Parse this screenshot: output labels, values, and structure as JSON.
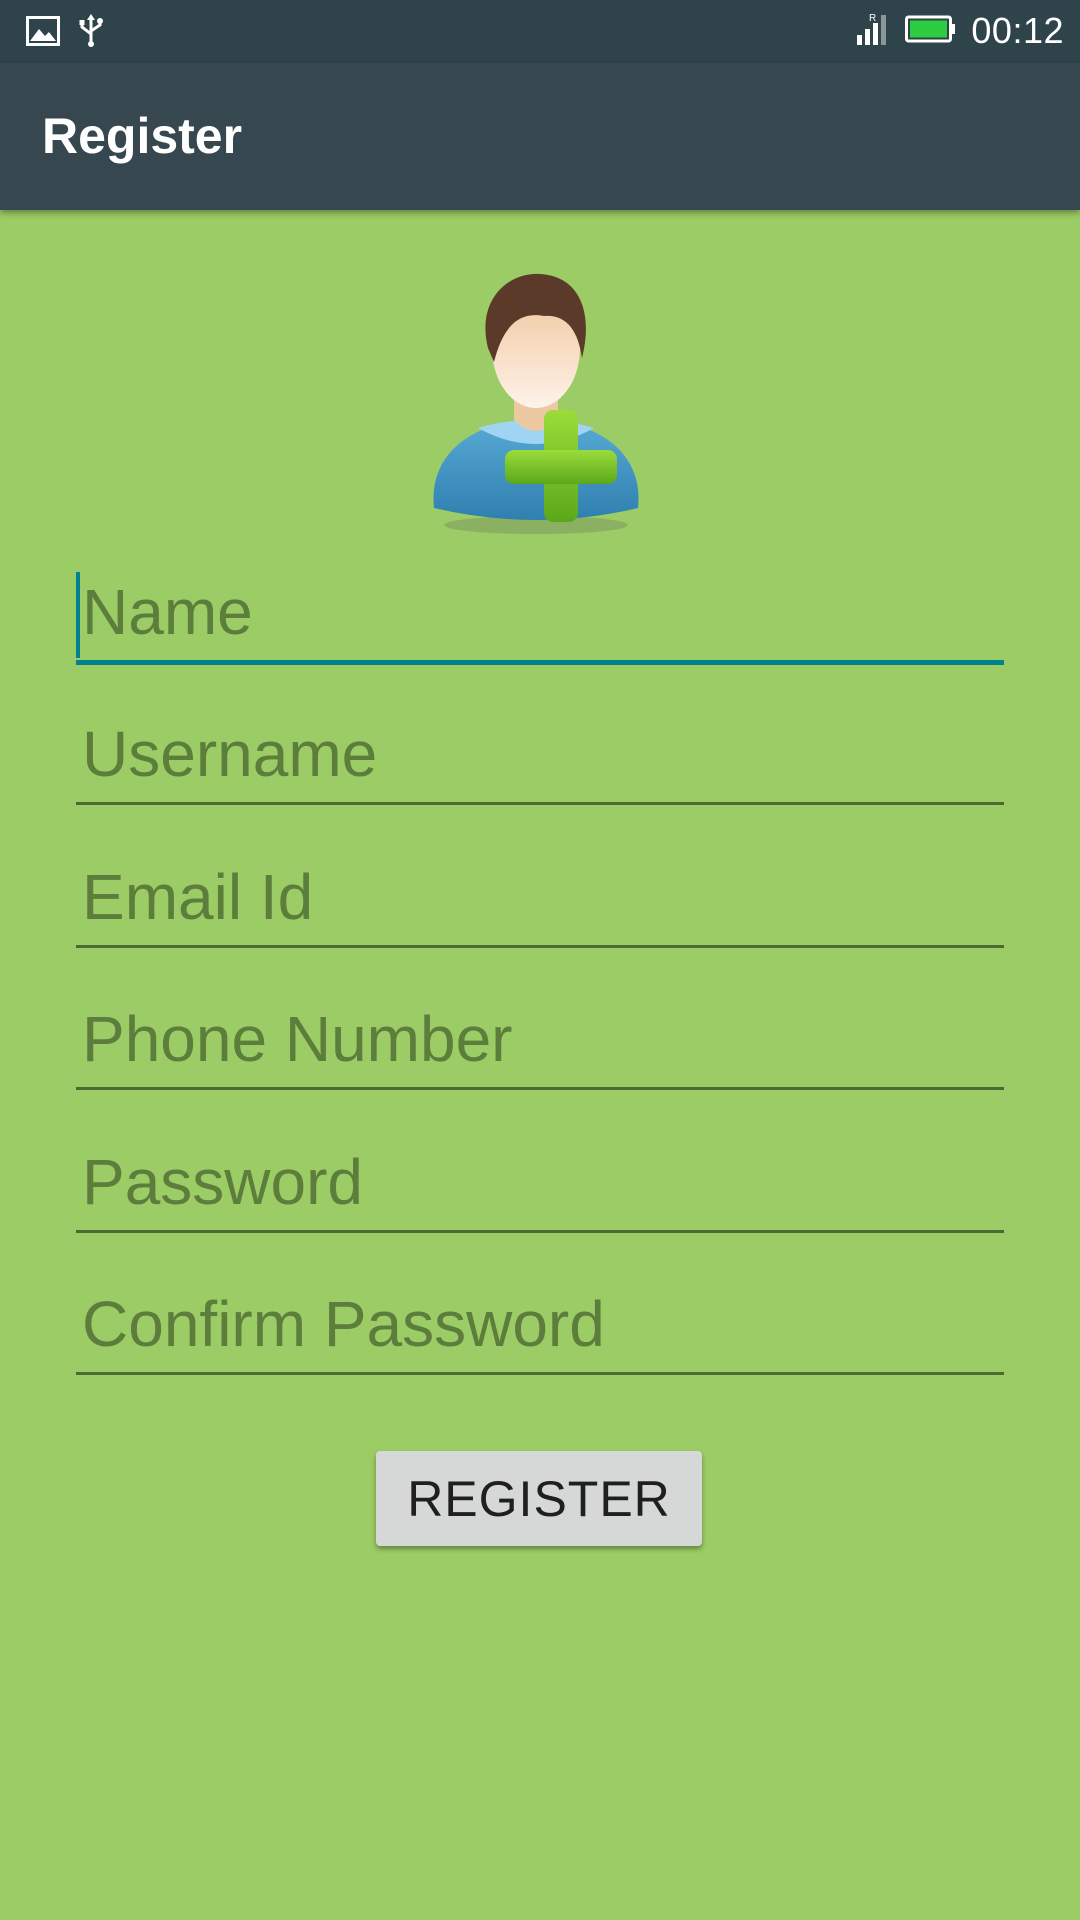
{
  "status_bar": {
    "time": "00:12",
    "icons": [
      "image-icon",
      "usb-icon",
      "signal-icon",
      "battery-icon"
    ],
    "signal_label": "R",
    "battery_color": "#2ecc40"
  },
  "app_bar": {
    "title": "Register",
    "color": "#37474f"
  },
  "avatar": {
    "icon": "add-user-icon"
  },
  "form": {
    "fields": [
      {
        "placeholder": "Name",
        "value": ""
      },
      {
        "placeholder": "Username",
        "value": ""
      },
      {
        "placeholder": "Email Id",
        "value": ""
      },
      {
        "placeholder": "Phone Number",
        "value": ""
      },
      {
        "placeholder": "Password",
        "value": ""
      },
      {
        "placeholder": "Confirm Password",
        "value": ""
      }
    ],
    "focused_field": "Name",
    "register_label": "REGISTER"
  },
  "colors": {
    "background": "#9ccc65",
    "accent": "#00838f",
    "status_bar": "#2e434a"
  }
}
